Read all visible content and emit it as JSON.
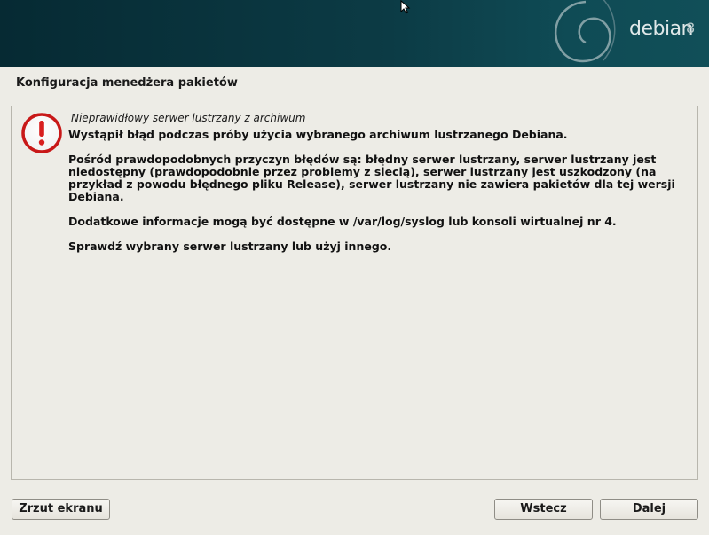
{
  "header": {
    "logo_text": "debian",
    "logo_version": "8"
  },
  "page": {
    "title": "Konfiguracja menedżera pakietów"
  },
  "dialog": {
    "icon": "error-icon",
    "title": "Nieprawidłowy serwer lustrzany z archiwum",
    "paragraphs": [
      "Wystąpił błąd podczas próby użycia wybranego archiwum lustrzanego Debiana.",
      "Pośród prawdopodobnych przyczyn błędów są: błędny serwer lustrzany, serwer lustrzany jest niedostępny (prawdopodobnie przez problemy z siecią), serwer lustrzany jest uszkodzony (na przykład z powodu błędnego pliku Release), serwer lustrzany nie zawiera pakietów dla tej wersji Debiana.",
      "Dodatkowe informacje mogą być dostępne w /var/log/syslog lub konsoli wirtualnej nr 4.",
      "Sprawdź wybrany serwer lustrzany lub użyj innego."
    ]
  },
  "buttons": {
    "screenshot": "Zrzut ekranu",
    "back": "Wstecz",
    "next": "Dalej"
  },
  "colors": {
    "banner": "#0c3b45",
    "background": "#edece6",
    "error": "#d81f1f"
  }
}
